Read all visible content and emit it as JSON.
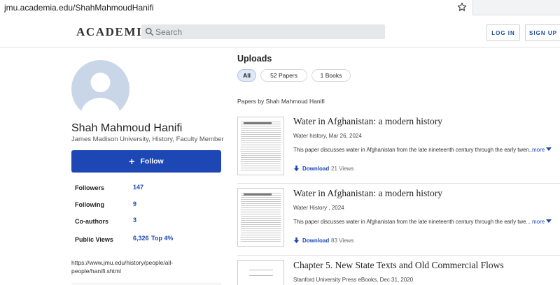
{
  "browser": {
    "url": "jmu.academia.edu/ShahMahmoudHanifi",
    "star_icon": "star-outline-icon"
  },
  "header": {
    "logo": "ACADEMIA",
    "search_placeholder": "Search",
    "login_label": "LOG IN",
    "signup_label": "SIGN UP"
  },
  "profile": {
    "name": "Shah Mahmoud Hanifi",
    "affiliation": "James Madison University, History, Faculty Member",
    "follow_label": "Follow",
    "stats": [
      {
        "label": "Followers",
        "value": "147"
      },
      {
        "label": "Following",
        "value": "9"
      },
      {
        "label": "Co-authors",
        "value": "3"
      },
      {
        "label": "Public Views",
        "value": "6,326",
        "extra": "Top 4%"
      }
    ],
    "website": "https://www.jmu.edu/history/people/all-people/hanifi.shtml"
  },
  "uploads": {
    "title": "Uploads",
    "tabs": [
      {
        "label": "All",
        "active": true
      },
      {
        "label": "52 Papers",
        "active": false
      },
      {
        "label": "1 Books",
        "active": false
      }
    ],
    "papers_by": "Papers by Shah Mahmoud Hanifi",
    "papers": [
      {
        "title": "Water in Afghanistan: a modern history",
        "meta": "Water history, Mar 26, 2024",
        "abstract": "This paper discusses water in Afghanistan from the late nineteenth century through the early twen...",
        "more": "more",
        "download": "Download",
        "views": "21 Views"
      },
      {
        "title": "Water in Afghanistan: a modern history",
        "meta": "Water History , 2024",
        "abstract": "This paper discusses water in Afghanistan from the late nineteenth century through the early twe...",
        "more": "more",
        "download": "Download",
        "views": "83 Views"
      },
      {
        "title": "Chapter 5. New State Texts and Old Commercial Flows",
        "meta": "Stanford University Press eBooks, Dec 31, 2020"
      }
    ]
  },
  "colors": {
    "accent": "#1c47b5",
    "avatar_bg": "#c9d6e8"
  }
}
